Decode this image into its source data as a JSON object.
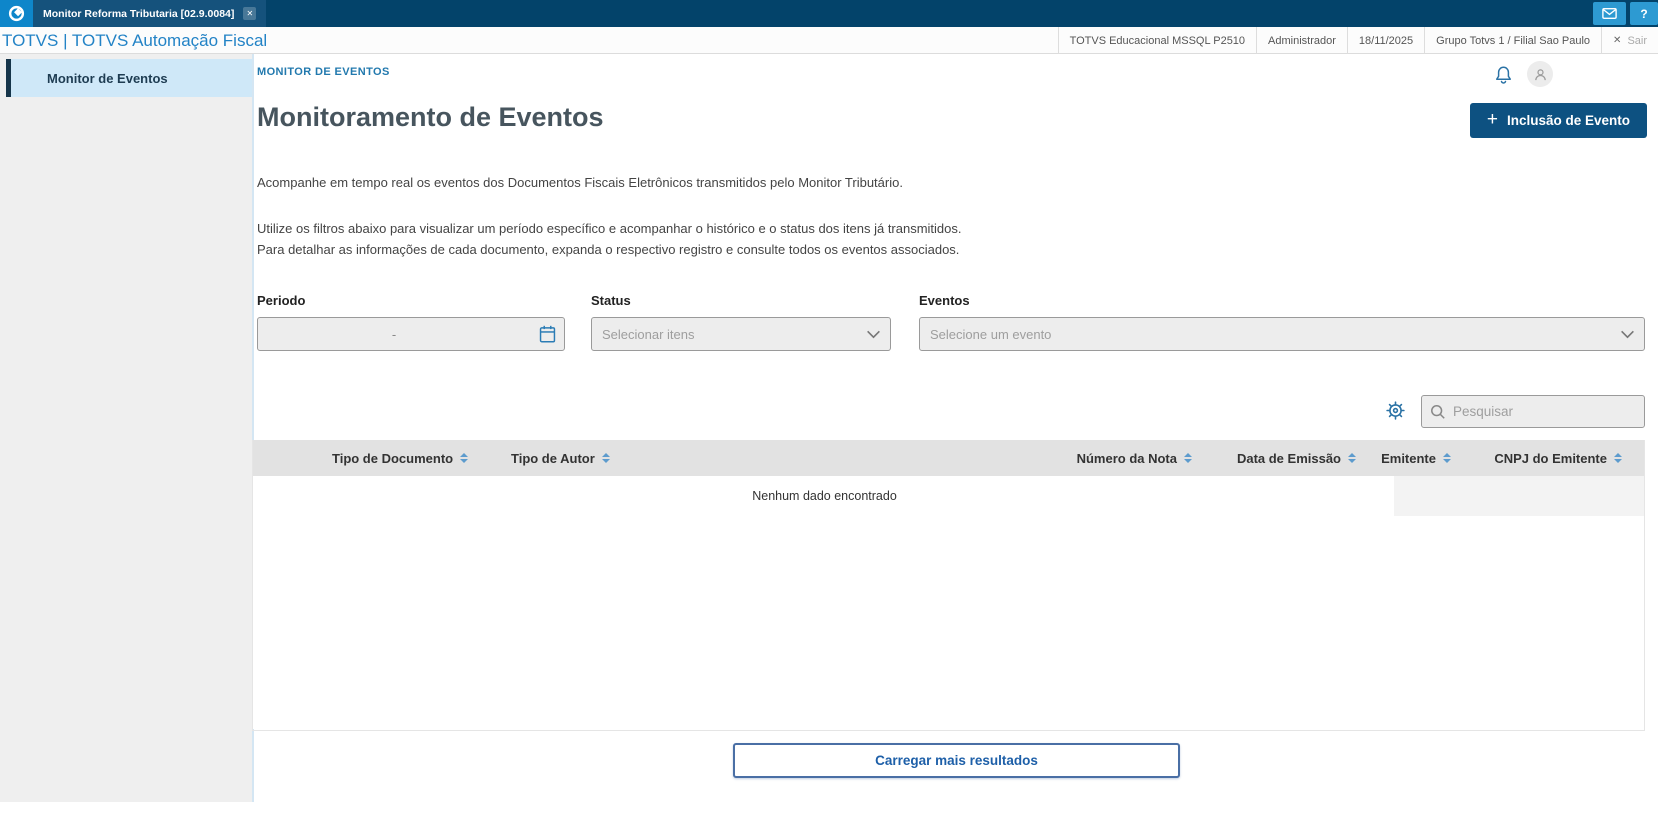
{
  "window": {
    "tab_title": "Monitor Reforma Tributaria [02.9.0084]",
    "close_glyph": "✕"
  },
  "header": {
    "brand": "TOTVS | TOTVS Automação Fiscal",
    "environment": "TOTVS Educacional MSSQL P2510",
    "user": "Administrador",
    "date": "18/11/2025",
    "company": "Grupo Totvs 1 / Filial Sao Paulo",
    "logout_label": "Sair",
    "logout_glyph": "✕",
    "help_glyph": "?"
  },
  "sidebar": {
    "items": [
      {
        "label": "Monitor de Eventos",
        "active": true
      }
    ]
  },
  "main": {
    "breadcrumb": "MONITOR DE EVENTOS",
    "title": "Monitoramento de Eventos",
    "add_button": {
      "plus_glyph": "+",
      "label": "Inclusão de Evento"
    },
    "intro": "Acompanhe em tempo real os eventos dos Documentos Fiscais Eletrônicos transmitidos pelo Monitor Tributário.",
    "instructions_line1": "Utilize os filtros abaixo para visualizar um período específico e acompanhar o histórico e o status dos itens já transmitidos.",
    "instructions_line2": "Para detalhar as informações de cada documento, expanda o respectivo registro e consulte todos os eventos associados.",
    "filters": {
      "period": {
        "label": "Periodo",
        "value": "-"
      },
      "status": {
        "label": "Status",
        "placeholder": "Selecionar itens"
      },
      "events": {
        "label": "Eventos",
        "placeholder": "Selecione um evento"
      }
    },
    "search": {
      "placeholder": "Pesquisar"
    },
    "table": {
      "columns": [
        "Tipo de Documento",
        "Tipo de Autor",
        "Número da Nota",
        "Data de Emissão",
        "Emitente",
        "CNPJ do Emitente"
      ],
      "empty_message": "Nenhum dado encontrado"
    },
    "load_more_label": "Carregar mais resultados"
  },
  "colors": {
    "topbar_navy": "#03436a",
    "tab_navy": "#15527c",
    "logo_blue": "#0e86ca",
    "top_icon_blue": "#2d9ad2",
    "brand_blue": "#2383c6",
    "breadcrumb_blue": "#2279ae",
    "primary_button_blue": "#0d5181",
    "load_more_blue": "#1d5fa8",
    "sidebar_active_bg": "#cfe8f8",
    "sidebar_active_bar": "#16354a",
    "table_header_bg": "#e2e2e2",
    "input_bg": "#ededed"
  }
}
